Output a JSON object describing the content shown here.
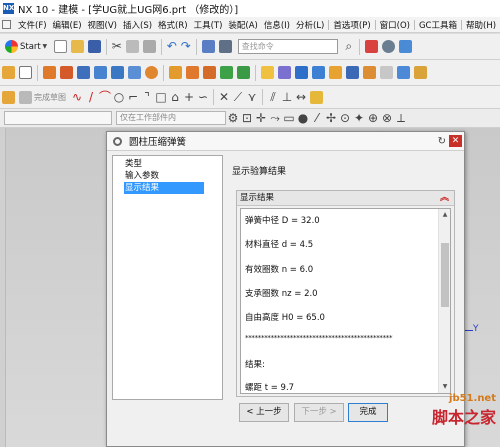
{
  "window": {
    "app_logo": "NX",
    "title": "NX 10 - 建模 - [学UG就上UG网6.prt （修改的）]"
  },
  "menu": [
    "文件(F)",
    "编辑(E)",
    "视图(V)",
    "插入(S)",
    "格式(R)",
    "工具(T)",
    "装配(A)",
    "信息(I)",
    "分析(L)",
    "首选项(P)",
    "窗口(O)",
    "GC工具箱",
    "帮助(H)"
  ],
  "toolbar": {
    "start_label": "Start",
    "search_placeholder": "查找命令",
    "finish_sketch_label": "完成草图",
    "filter_select_value": "仅在工作部件内"
  },
  "dialog": {
    "title": "圆柱压缩弹簧",
    "tree": [
      {
        "label": "类型",
        "selected": false
      },
      {
        "label": "输入参数",
        "selected": false
      },
      {
        "label": "显示结果",
        "selected": true
      }
    ],
    "result_heading": "显示验算结果",
    "group_label": "显示结果",
    "lines": [
      "弹簧中径 D = 32.0",
      "材料直径 d = 4.5",
      "有效圈数 n = 6.0",
      "支承圈数 nz = 2.0",
      "自由高度 H0 = 65.0",
      "**********************************************",
      "结果:",
      "螺距 t = 9.7"
    ],
    "buttons": {
      "back": "< 上一步",
      "next": "下一步 >",
      "finish": "完成"
    }
  },
  "axis_label": "Y",
  "watermark": {
    "url": "jb51.net",
    "name": "脚本之家"
  },
  "colors": {
    "selection": "#3399ff",
    "close": "#c8312a",
    "axis": "#2a3fc8",
    "chevron": "#cc2222"
  }
}
